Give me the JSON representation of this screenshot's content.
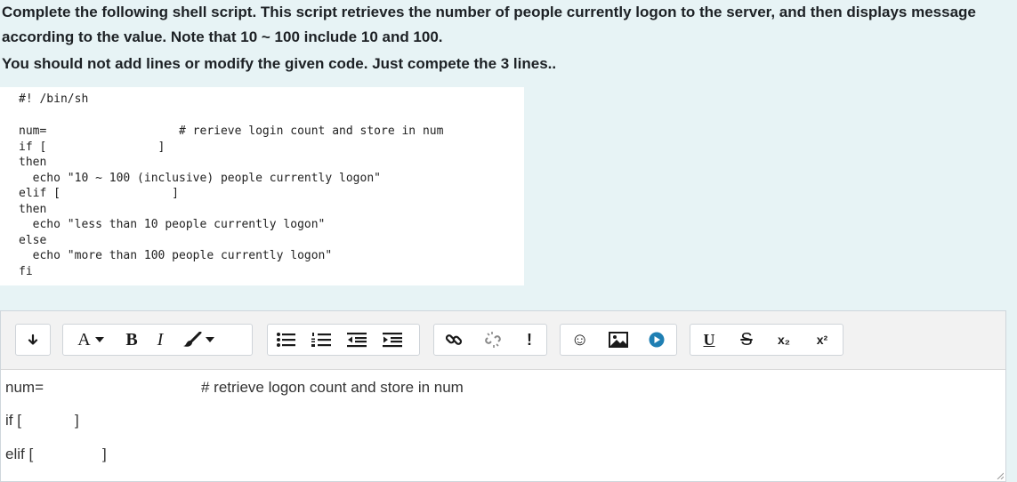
{
  "question": {
    "text": "Complete the following shell script. This script retrieves the number of people currently logon to the server, and then displays message according to the value.  Note that 10 ~ 100 include 10 and 100.",
    "note": "You should not add lines or modify the given code. Just compete the 3 lines.."
  },
  "code": {
    "shebang": "#! /bin/sh",
    "body": "num=                   # rerieve login count and store in num\nif [                ]\nthen\n  echo \"10 ~ 100 (inclusive) people currently logon\"\nelif [                ]\nthen\n  echo \"less than 10 people currently logon\"\nelse\n  echo \"more than 100 people currently logon\"\nfi"
  },
  "toolbar": {
    "font_label": "A",
    "bold_label": "B",
    "italic_label": "I",
    "emoticon_glyph": "☺",
    "subscript_label": "x₂",
    "superscript_label": "x²",
    "warning_glyph": "!"
  },
  "editor": {
    "lines": [
      {
        "left": "num=",
        "right": "# retrieve logon count and store in num"
      },
      {
        "left": "if [",
        "right": "]"
      },
      {
        "left": "elif [",
        "right": "]"
      }
    ]
  }
}
